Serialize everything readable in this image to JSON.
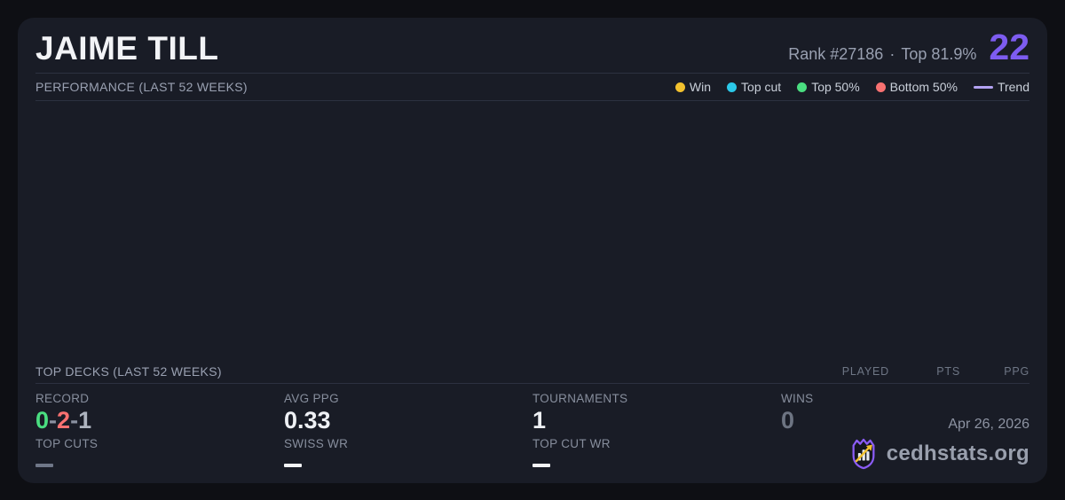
{
  "page": {
    "background": "#0e0f14",
    "card_background": "#191c26"
  },
  "header": {
    "player_name": "JAIME TILL",
    "rank_text": "Rank #27186",
    "dot_separator": "·",
    "top_percent_text": "Top 81.9%",
    "score": "22",
    "score_color": "#7d5cf0"
  },
  "performance": {
    "title": "PERFORMANCE (LAST 52 WEEKS)",
    "chart_points": [],
    "legend": [
      {
        "label": "Win",
        "color": "#f2c12e",
        "swatch": "dot"
      },
      {
        "label": "Top cut",
        "color": "#2bc8e8",
        "swatch": "dot"
      },
      {
        "label": "Top 50%",
        "color": "#4ade80",
        "swatch": "dot"
      },
      {
        "label": "Bottom 50%",
        "color": "#f87171",
        "swatch": "dot"
      },
      {
        "label": "Trend",
        "color": "#b3a2f2",
        "swatch": "line"
      }
    ]
  },
  "top_decks": {
    "title": "TOP DECKS (LAST 52 WEEKS)",
    "columns": [
      "PLAYED",
      "PTS",
      "PPG"
    ],
    "rows": []
  },
  "stats": {
    "record": {
      "label": "RECORD",
      "parts": [
        {
          "text": "0",
          "color": "#4ade80"
        },
        {
          "text": "-",
          "color": "#8a91a0"
        },
        {
          "text": "2",
          "color": "#f87171"
        },
        {
          "text": "-",
          "color": "#8a91a0"
        },
        {
          "text": "1",
          "color": "#aeb4bf"
        }
      ]
    },
    "avg_ppg": {
      "label": "AVG PPG",
      "value": "0.33"
    },
    "tournaments": {
      "label": "TOURNAMENTS",
      "value": "1"
    },
    "wins": {
      "label": "WINS",
      "value": "0",
      "value_color": "#6d7482"
    },
    "top_cuts": {
      "label": "TOP CUTS",
      "value": "—",
      "dash_color": "#6f7788"
    },
    "swiss_wr": {
      "label": "SWISS WR",
      "value": "—",
      "dash_color": "#f3f4f7"
    },
    "top_cut_wr": {
      "label": "TOP CUT WR",
      "value": "—",
      "dash_color": "#f3f4f7"
    }
  },
  "footer": {
    "date": "Apr 26, 2026",
    "brand": "cedhstats.org",
    "logo_stroke": "#8b5cf6",
    "logo_arrow": "#f2c12e"
  }
}
